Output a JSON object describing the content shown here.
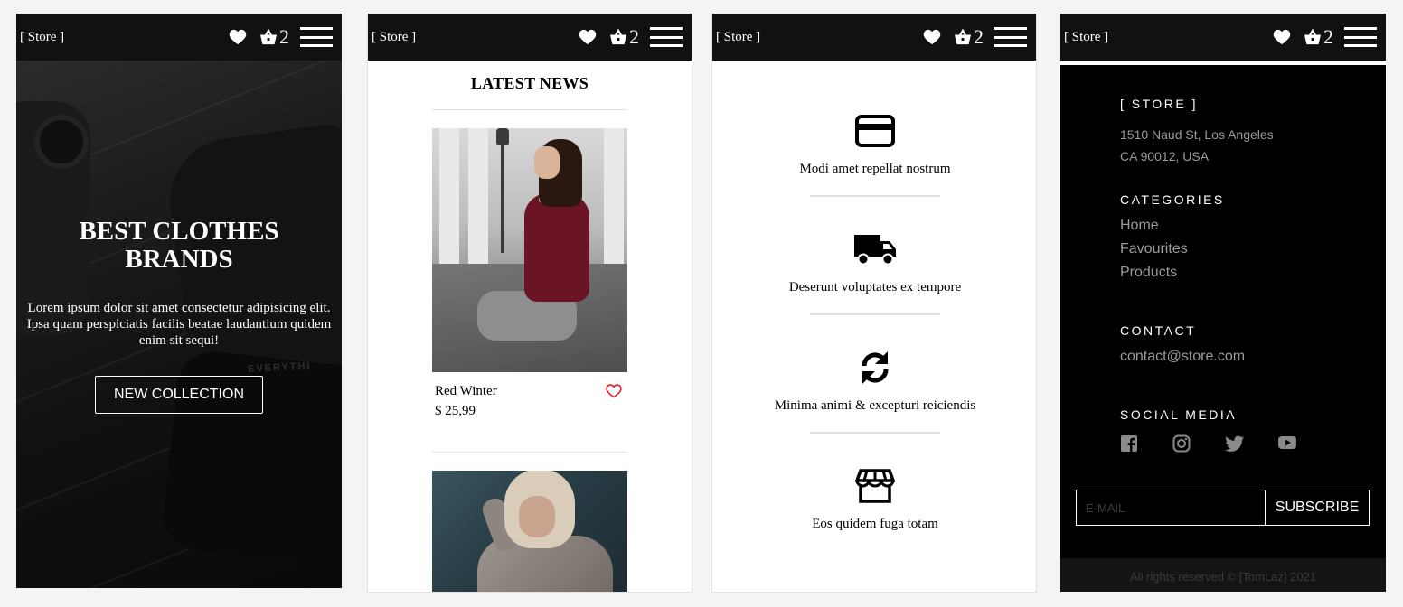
{
  "nav": {
    "brand": "[ Store ]",
    "cart_count": "2"
  },
  "hero": {
    "title_line1": "BEST CLOTHES",
    "title_line2": "BRANDS",
    "text": "Lorem ipsum dolor sit amet consectetur adipisicing elit. Ipsa quam perspiciatis facilis beatae laudantium quidem enim sit sequi!",
    "button": "NEW COLLECTION",
    "image_text": "EVERYTHI"
  },
  "news": {
    "title": "LATEST NEWS",
    "products": [
      {
        "name": "Red Winter",
        "price": "$ 25,99"
      }
    ]
  },
  "features": [
    {
      "icon": "credit-card-icon",
      "text": "Modi amet repellat nostrum"
    },
    {
      "icon": "truck-icon",
      "text": "Deserunt voluptates ex tempore"
    },
    {
      "icon": "sync-icon",
      "text": "Minima animi & excepturi reiciendis"
    },
    {
      "icon": "store-icon",
      "text": "Eos quidem fuga totam"
    }
  ],
  "footer": {
    "store_title": "[ STORE ]",
    "address_line1": "1510 Naud St, Los Angeles",
    "address_line2": "CA 90012, USA",
    "categories_title": "CATEGORIES",
    "categories": [
      "Home",
      "Favourites",
      "Products"
    ],
    "contact_title": "CONTACT",
    "email": "contact@store.com",
    "social_title": "SOCIAL MEDIA",
    "social": [
      "facebook-icon",
      "instagram-icon",
      "twitter-icon",
      "youtube-icon"
    ],
    "email_placeholder": "E-MAIL",
    "subscribe": "SUBSCRIBE",
    "copyright": "All rights reserved © [TomLaz] 2021"
  },
  "colors": {
    "nav_bg": "#111111",
    "favorite_red": "#e0232e",
    "footer_bg": "#000000",
    "muted_text": "#9a9a9a"
  }
}
